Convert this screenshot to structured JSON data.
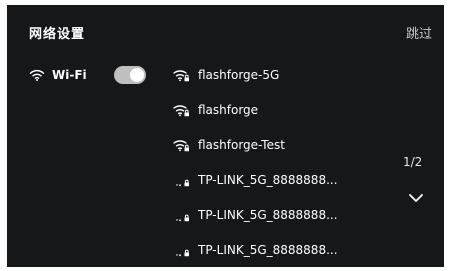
{
  "header": {
    "title": "网络设置",
    "skip_label": "跳过"
  },
  "wifi": {
    "label": "Wi-Fi",
    "enabled": true
  },
  "networks": [
    {
      "name": "flashforge-5G",
      "signal": "full"
    },
    {
      "name": "flashforge",
      "signal": "full"
    },
    {
      "name": "flashforge-Test",
      "signal": "full"
    },
    {
      "name": "TP-LINK_5G_8888888...",
      "signal": "weak"
    },
    {
      "name": "TP-LINK_5G_8888888...",
      "signal": "weak"
    },
    {
      "name": "TP-LINK_5G_8888888...",
      "signal": "weak"
    }
  ],
  "pagination": {
    "indicator": "1/2"
  },
  "colors": {
    "background": "#161718",
    "text": "#ffffff",
    "toggle_track": "#bfbfbf"
  }
}
